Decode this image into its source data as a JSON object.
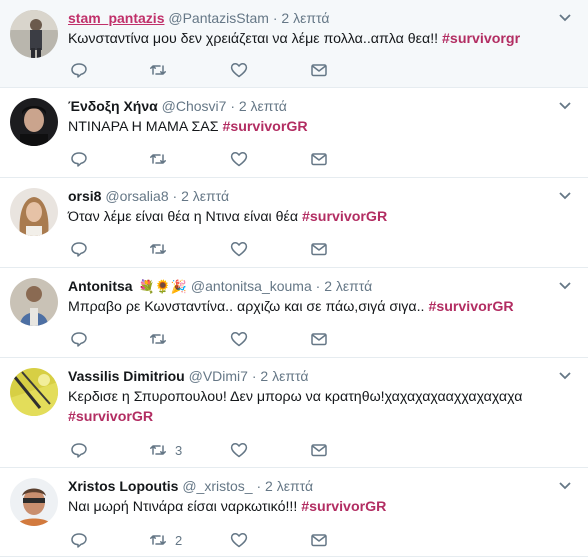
{
  "tweets": [
    {
      "name": "stam_pantazis",
      "handle": "@PantazisStam",
      "separator": "·",
      "time": "2 λεπτά",
      "text": "Κωνσταντίνα μου δεν χρειάζεται να λέμε πολλα..απλα θεα!!",
      "hashtag": "#survivorgr",
      "reply_count": "",
      "retweet_count": "",
      "like_count": ""
    },
    {
      "name": "Ένδοξη Χήνα",
      "handle": "@Chosvi7",
      "separator": "·",
      "time": "2 λεπτά",
      "text": "ΝΤΙΝΑΡΑ Η ΜΑΜΑ ΣΑΣ",
      "hashtag": "#survivorGR",
      "reply_count": "",
      "retweet_count": "",
      "like_count": ""
    },
    {
      "name": "orsi8",
      "handle": "@orsalia8",
      "separator": "·",
      "time": "2 λεπτά",
      "text": "Όταν λέμε είναι θέα η Ντινα είναι θέα",
      "hashtag": "#survivorGR",
      "reply_count": "",
      "retweet_count": "",
      "like_count": ""
    },
    {
      "name": "Antonitsa",
      "name_emojis": "💐🌻🎉",
      "handle": "@antonitsa_kouma",
      "separator": "·",
      "time": "2 λεπτά",
      "text": "Μπραβο ρε Κωνσταντίνα.. αρχιζω και σε πάω,σιγά σιγα..",
      "hashtag": "#survivorGR",
      "reply_count": "",
      "retweet_count": "",
      "like_count": ""
    },
    {
      "name": "Vassilis Dimitriou",
      "handle": "@VDimi7",
      "separator": "·",
      "time": "2 λεπτά",
      "text": "Κερδισε η Σπυροπουλου! Δεν μπορω να κρατηθω!χαχαχαχααχχαχαχαχα",
      "hashtag": "#survivorGR",
      "reply_count": "",
      "retweet_count": "3",
      "like_count": ""
    },
    {
      "name": "Xristos Lopoutis",
      "handle": "@_xristos_",
      "separator": "·",
      "time": "2 λεπτά",
      "text": "Ναι μωρή Ντινάρα είσαι ναρκωτικό!!!",
      "hashtag": "#survivorGR",
      "reply_count": "",
      "retweet_count": "2",
      "like_count": ""
    }
  ],
  "icons": {
    "reply": "reply-icon",
    "retweet": "retweet-icon",
    "like": "heart-icon",
    "message": "envelope-icon",
    "caret": "chevron-down-icon"
  },
  "colors": {
    "hashtag": "#b22d62",
    "highlight_name": "#c0306a",
    "muted": "#657786",
    "highlight_bg": "#f5f8fa"
  }
}
